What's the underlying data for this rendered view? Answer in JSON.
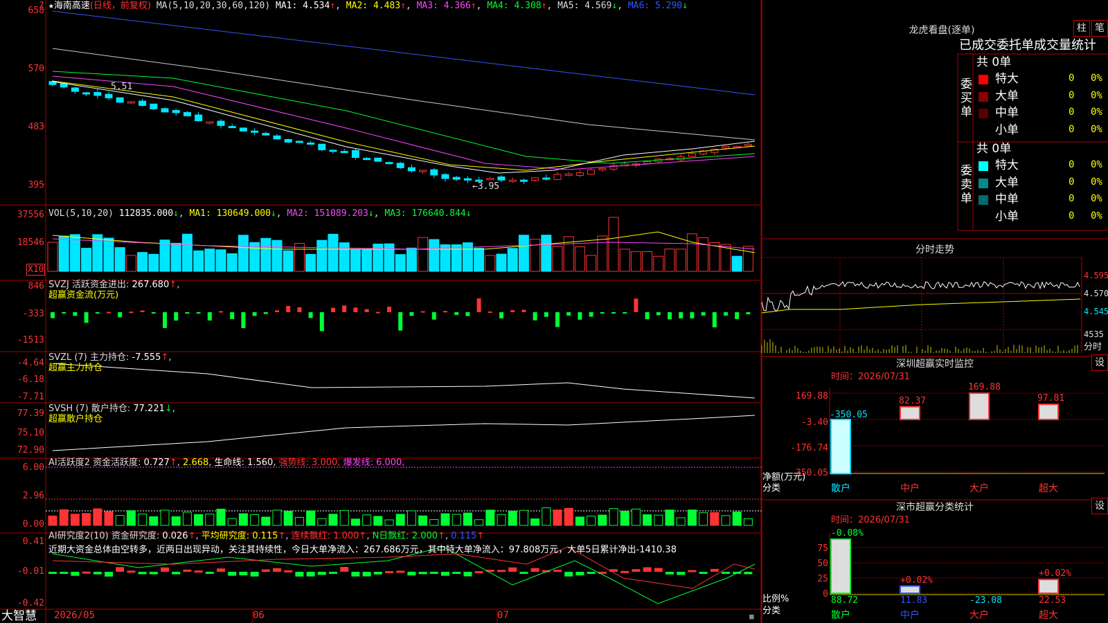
{
  "colors": {
    "up": "#ff3333",
    "down": "#00e5ff",
    "grid": "#b00000",
    "text": "#dddddd",
    "yellow": "#ffff00",
    "magenta": "#ff44ff",
    "green": "#00ff33",
    "white": "#ffffff",
    "blue": "#3355ff"
  },
  "main_chart": {
    "stock": "海南高速",
    "period": "(日线，前复权)",
    "ma_label": "MA(5,10,20,30,60,120)",
    "ma": [
      {
        "label": "MA1:",
        "value": "4.534",
        "arrow": "↑"
      },
      {
        "label": "MA2:",
        "value": "4.483",
        "arrow": "↑"
      },
      {
        "label": "MA3:",
        "value": "4.366",
        "arrow": "↑"
      },
      {
        "label": "MA4:",
        "value": "4.308",
        "arrow": "↑"
      },
      {
        "label": "MA5:",
        "value": "4.569",
        "arrow": "↓"
      },
      {
        "label": "MA6:",
        "value": "5.290",
        "arrow": "↓"
      }
    ],
    "y_ticks": [
      "658",
      "570",
      "483",
      "395"
    ],
    "high_note": "5.51",
    "low_note": "3.95"
  },
  "vol_panel": {
    "title": "VOL(5,10,20)",
    "value": "112835.000",
    "ma": [
      {
        "label": "MA1:",
        "value": "130649.000",
        "arrow": "↓"
      },
      {
        "label": "MA2:",
        "value": "151089.203",
        "arrow": "↓"
      },
      {
        "label": "MA3:",
        "value": "176640.844",
        "arrow": "↓"
      }
    ],
    "y_ticks": [
      "37556",
      "18546"
    ],
    "unit": "X10"
  },
  "svzj_panel": {
    "title": "SVZJ 活跃资金进出:",
    "value": "267.680",
    "arrow": "↑",
    "sub": "超赢资金流(万元)",
    "y_ticks": [
      "846",
      "-333",
      "-1513"
    ]
  },
  "svzl_panel": {
    "title": "SVZL (7) 主力持仓:",
    "value": "-7.555",
    "arrow": "↑",
    "sub": "超赢主力持仓",
    "y_ticks": [
      "-4.64",
      "-6.18",
      "-7.71"
    ]
  },
  "svsh_panel": {
    "title": "SVSH (7) 散户持仓:",
    "value": "77.221",
    "arrow": "↓",
    "sub": "超赢散户持仓",
    "y_ticks": [
      "77.39",
      "75.10",
      "72.90"
    ]
  },
  "ai_act_panel": {
    "title": "AI活跃度2 资金活跃度:",
    "v1": "0.727",
    "v2": "2.668",
    "life_label": "生命线:",
    "life": "1.560",
    "strong": "强势线: 3.000,",
    "burst": "爆发线: 6.000,",
    "y_ticks": [
      "6.00",
      "2.96",
      "0.00"
    ]
  },
  "ai_res_panel": {
    "title": "AI研究度2(10) 资金研究度:",
    "v1": "0.026",
    "avg_label": "平均研究度:",
    "avg": "0.115",
    "cont_label": "连续飘红:",
    "cont": "1.000",
    "n_label": "N日飘红:",
    "n": "2.000",
    "v5": "0.115",
    "comment": "近期大资金总体由空转多，近两日出现异动，关注其持续性，今日大单净流入：267.686万元，其中特大单净流入：97.808万元，大单5日累计净出-1410.38",
    "y_ticks": [
      "0.41",
      "-0.01",
      "-0.42"
    ]
  },
  "bottom": {
    "brand": "大智慧",
    "dates": [
      "2026/05",
      "06",
      "07"
    ]
  },
  "dragon": {
    "title": "龙虎看盘(逐单)",
    "btn1": "柱",
    "btn2": "笔",
    "subtitle": "已成交委托单成交量统计",
    "buy_label": "委买单",
    "sell_label": "委卖单",
    "buy_total": "共 0单",
    "sell_total": "共 0单",
    "buy_rows": [
      {
        "name": "特大",
        "count": "0",
        "pct": "0%",
        "color": "#ff0000"
      },
      {
        "name": "大单",
        "count": "0",
        "pct": "0%",
        "color": "#8a0000"
      },
      {
        "name": "中单",
        "count": "0",
        "pct": "0%",
        "color": "#5a0000"
      },
      {
        "name": "小单",
        "count": "0",
        "pct": "0%",
        "color": ""
      }
    ],
    "sell_rows": [
      {
        "name": "特大",
        "count": "0",
        "pct": "0%",
        "color": "#00ffff"
      },
      {
        "name": "大单",
        "count": "0",
        "pct": "0%",
        "color": "#008b8b"
      },
      {
        "name": "中单",
        "count": "0",
        "pct": "0%",
        "color": "#006b6b"
      },
      {
        "name": "小单",
        "count": "0",
        "pct": "0%",
        "color": ""
      }
    ]
  },
  "intraday": {
    "title": "分时走势",
    "y_ticks": [
      "4.595",
      "4.570",
      "4.545"
    ],
    "vol_tick": "4535",
    "vol_label": "分时"
  },
  "monitor": {
    "title": "深圳超赢实时监控",
    "btn": "设",
    "time": "时间：2026/07/31",
    "y_ticks": [
      "169.88",
      "-3.40",
      "-176.74",
      "-350.05"
    ],
    "y_label": "净额(万元)",
    "x_label": "分类",
    "bars": [
      {
        "name": "散户",
        "value": -350.05,
        "label": "-350.05"
      },
      {
        "name": "中户",
        "value": 82.37,
        "label": "82.37"
      },
      {
        "name": "大户",
        "value": 169.88,
        "label": "169.88"
      },
      {
        "name": "超大",
        "value": 97.81,
        "label": "97.81"
      }
    ]
  },
  "classify": {
    "title": "深市超赢分类统计",
    "btn": "设",
    "time": "时间：2026/07/31",
    "y_ticks": [
      "75",
      "50",
      "25",
      "0"
    ],
    "y_label": "比例%",
    "x_label": "分类",
    "bars": [
      {
        "name": "散户",
        "pct": 88.72,
        "pct_label": "88.72",
        "change": "-0.08%"
      },
      {
        "name": "中户",
        "pct": 11.83,
        "pct_label": "11.83",
        "change": "+0.02%"
      },
      {
        "name": "大户",
        "pct": -23.08,
        "pct_label": "-23.08",
        "change": ""
      },
      {
        "name": "超大",
        "pct": 22.53,
        "pct_label": "22.53",
        "change": "+0.02%"
      }
    ]
  }
}
